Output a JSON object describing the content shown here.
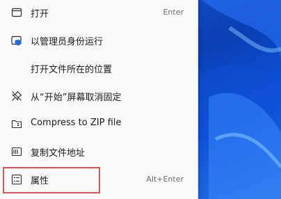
{
  "menu": {
    "items": [
      {
        "label": "打开",
        "shortcut": "Enter",
        "icon": "open-icon"
      },
      {
        "label": "以管理员身份运行",
        "shortcut": "",
        "icon": "shield-admin-icon"
      },
      {
        "label": "打开文件所在的位置",
        "shortcut": "",
        "icon": ""
      },
      {
        "label": "从“开始”屏幕取消固定",
        "shortcut": "",
        "icon": "unpin-icon"
      },
      {
        "label": "Compress to ZIP file",
        "shortcut": "",
        "icon": "zip-folder-icon"
      },
      {
        "label": "复制文件地址",
        "shortcut": "",
        "icon": "copy-path-icon"
      },
      {
        "label": "属性",
        "shortcut": "Alt+Enter",
        "icon": "properties-icon"
      }
    ]
  },
  "colors": {
    "menu_background": "#f9f9f9",
    "highlight_border": "#e05252",
    "wallpaper_blue": "#0a3fb3"
  }
}
